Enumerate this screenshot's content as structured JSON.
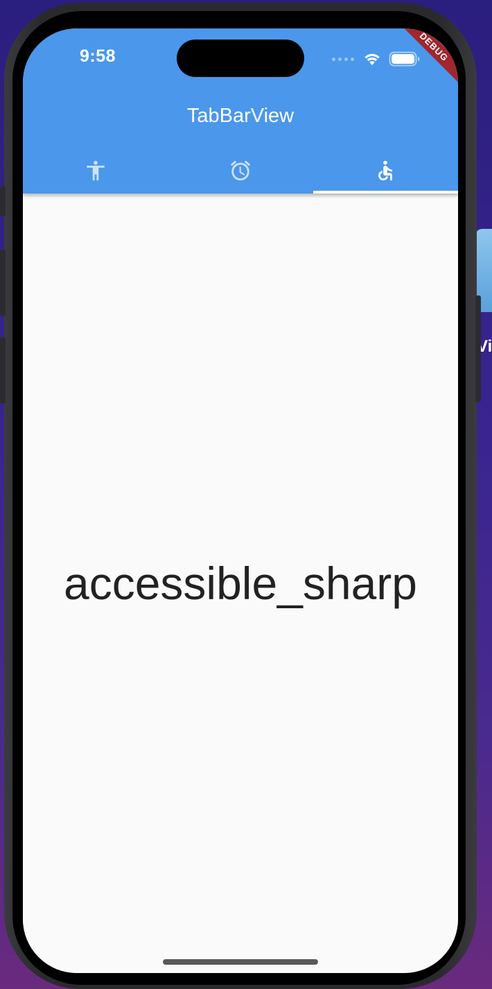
{
  "status_bar": {
    "time": "9:58",
    "icons": [
      "cellular-signal-icon",
      "wifi-icon",
      "battery-icon"
    ]
  },
  "debug_banner": {
    "label": "DEBUG",
    "color": "#a1262e"
  },
  "app_bar": {
    "title": "TabBarView",
    "background_color": "#4a97ec"
  },
  "tabs": [
    {
      "icon": "accessibility-icon",
      "selected": false
    },
    {
      "icon": "alarm-icon",
      "selected": false
    },
    {
      "icon": "accessible-icon",
      "selected": true
    }
  ],
  "content": {
    "text": "accessible_sharp"
  },
  "desktop_label": "Vi"
}
